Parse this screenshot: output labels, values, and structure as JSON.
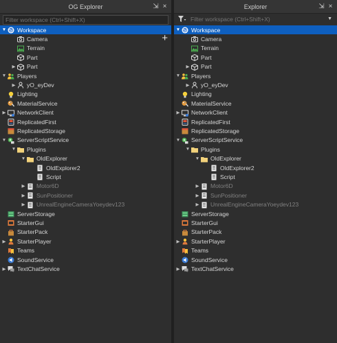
{
  "left_panel": {
    "title": "OG Explorer",
    "filter_placeholder": "Filter workspace (Ctrl+Shift+X)",
    "add_label": "+"
  },
  "right_panel": {
    "title": "Explorer",
    "filter_placeholder": "Filter workspace (Ctrl+Shift+X)"
  },
  "window_buttons": {
    "undock": "⇲",
    "close": "×"
  },
  "tree": [
    {
      "label": "Workspace",
      "depth": 0,
      "arrow": "down",
      "icon": "workspace-icon",
      "selected": true
    },
    {
      "label": "Camera",
      "depth": 1,
      "arrow": "",
      "icon": "camera-icon"
    },
    {
      "label": "Terrain",
      "depth": 1,
      "arrow": "",
      "icon": "terrain-icon"
    },
    {
      "label": "Part",
      "depth": 1,
      "arrow": "",
      "icon": "part-icon"
    },
    {
      "label": "Part",
      "depth": 1,
      "arrow": "right",
      "icon": "part-icon"
    },
    {
      "label": "Players",
      "depth": 0,
      "arrow": "down",
      "icon": "players-icon"
    },
    {
      "label": "yO_eyDev",
      "depth": 1,
      "arrow": "right",
      "icon": "player-icon"
    },
    {
      "label": "Lighting",
      "depth": 0,
      "arrow": "",
      "icon": "lighting-icon"
    },
    {
      "label": "MaterialService",
      "depth": 0,
      "arrow": "",
      "icon": "material-service-icon"
    },
    {
      "label": "NetworkClient",
      "depth": 0,
      "arrow": "right",
      "icon": "network-client-icon"
    },
    {
      "label": "ReplicatedFirst",
      "depth": 0,
      "arrow": "",
      "icon": "replicated-first-icon"
    },
    {
      "label": "ReplicatedStorage",
      "depth": 0,
      "arrow": "",
      "icon": "replicated-storage-icon"
    },
    {
      "label": "ServerScriptService",
      "depth": 0,
      "arrow": "down",
      "icon": "server-script-service-icon"
    },
    {
      "label": "Plugins",
      "depth": 1,
      "arrow": "down",
      "icon": "folder-icon"
    },
    {
      "label": "OldExplorer",
      "depth": 2,
      "arrow": "down",
      "icon": "folder-icon"
    },
    {
      "label": "OldExplorer2",
      "depth": 3,
      "arrow": "",
      "icon": "script-icon"
    },
    {
      "label": "Script",
      "depth": 3,
      "arrow": "",
      "icon": "script-icon"
    },
    {
      "label": "Motor6D",
      "depth": 2,
      "arrow": "right",
      "icon": "script-icon",
      "dim": true
    },
    {
      "label": "SunPositioner",
      "depth": 2,
      "arrow": "right",
      "icon": "script-icon",
      "dim": true
    },
    {
      "label": "UnrealEngineCameraYoeydev123",
      "depth": 2,
      "arrow": "right",
      "icon": "script-icon",
      "dim": true
    },
    {
      "label": "ServerStorage",
      "depth": 0,
      "arrow": "",
      "icon": "server-storage-icon"
    },
    {
      "label": "StarterGui",
      "depth": 0,
      "arrow": "",
      "icon": "starter-gui-icon"
    },
    {
      "label": "StarterPack",
      "depth": 0,
      "arrow": "",
      "icon": "starter-pack-icon"
    },
    {
      "label": "StarterPlayer",
      "depth": 0,
      "arrow": "right",
      "icon": "starter-player-icon"
    },
    {
      "label": "Teams",
      "depth": 0,
      "arrow": "",
      "icon": "teams-icon"
    },
    {
      "label": "SoundService",
      "depth": 0,
      "arrow": "",
      "icon": "sound-service-icon"
    },
    {
      "label": "TextChatService",
      "depth": 0,
      "arrow": "right",
      "icon": "text-chat-service-icon"
    }
  ],
  "colors": {
    "selection": "#0e5fbf",
    "background": "#2e2e2e"
  }
}
